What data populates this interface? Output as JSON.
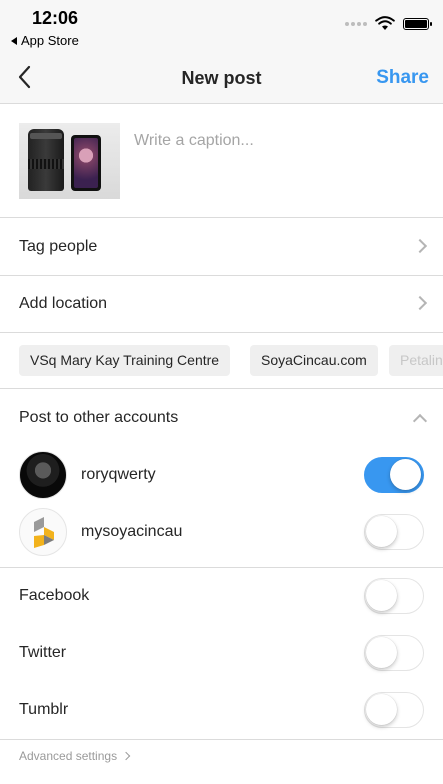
{
  "status_bar": {
    "time": "12:06",
    "back_app": "App Store"
  },
  "nav": {
    "title": "New post",
    "share_label": "Share"
  },
  "caption": {
    "placeholder": "Write a caption..."
  },
  "rows": {
    "tag_people": "Tag people",
    "add_location": "Add location"
  },
  "location_suggestions": [
    "VSq Mary Kay Training Centre",
    "SoyaCincau.com",
    "Petaling"
  ],
  "other_accounts": {
    "heading": "Post to other accounts",
    "accounts": [
      {
        "username": "roryqwerty",
        "enabled": true
      },
      {
        "username": "mysoyacincau",
        "enabled": false
      }
    ]
  },
  "share_to": [
    {
      "label": "Facebook",
      "enabled": false
    },
    {
      "label": "Twitter",
      "enabled": false
    },
    {
      "label": "Tumblr",
      "enabled": false
    }
  ],
  "advanced_settings": "Advanced settings",
  "colors": {
    "accent": "#3897f0",
    "divider": "#dbdbdb",
    "chip_bg": "#efefef"
  }
}
